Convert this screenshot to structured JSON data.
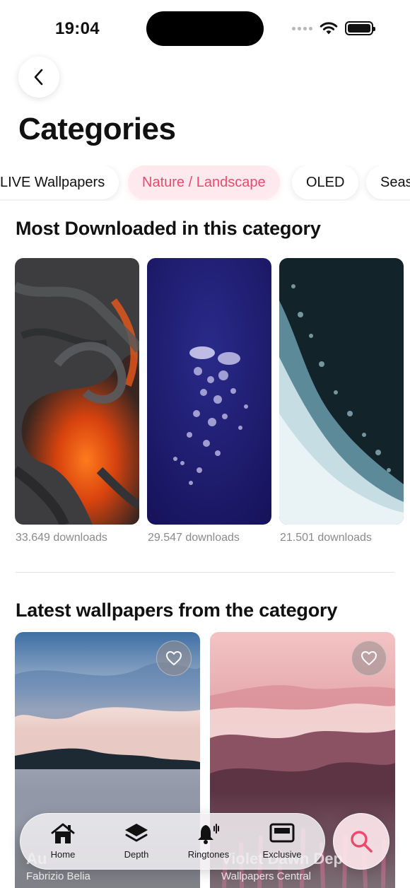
{
  "status_bar": {
    "time": "19:04"
  },
  "header": {
    "back_icon": "chevron-left-icon",
    "title": "Categories"
  },
  "chips": [
    {
      "label": "LIVE Wallpapers",
      "active": false
    },
    {
      "label": "Nature / Landscape",
      "active": true
    },
    {
      "label": "OLED",
      "active": false
    },
    {
      "label": "Seas",
      "active": false
    }
  ],
  "most_downloaded": {
    "title": "Most Downloaded in this category",
    "items": [
      {
        "caption": "33.649 downloads",
        "subject": "lava"
      },
      {
        "caption": "29.547 downloads",
        "subject": "bubbles"
      },
      {
        "caption": "21.501 downloads",
        "subject": "ocean-wave"
      }
    ]
  },
  "latest": {
    "title": "Latest wallpapers from the category",
    "items": [
      {
        "name": "Au",
        "author": "Fabrizio Belia",
        "subject": "lake-sky"
      },
      {
        "name": "Violet Dawn Dep",
        "author": "Wallpapers Central",
        "subject": "pink-mountains-flowers"
      }
    ]
  },
  "tab_bar": {
    "tabs": [
      {
        "label": "Home",
        "icon": "home-icon"
      },
      {
        "label": "Depth",
        "icon": "layers-icon"
      },
      {
        "label": "Ringtones",
        "icon": "bell-icon"
      },
      {
        "label": "Exclusive",
        "icon": "exclusive-icon"
      }
    ],
    "search_icon": "search-icon"
  },
  "colors": {
    "accent": "#ec4a6c",
    "chip_active_bg": "#fde9ee",
    "caption": "#8a8a8a"
  }
}
